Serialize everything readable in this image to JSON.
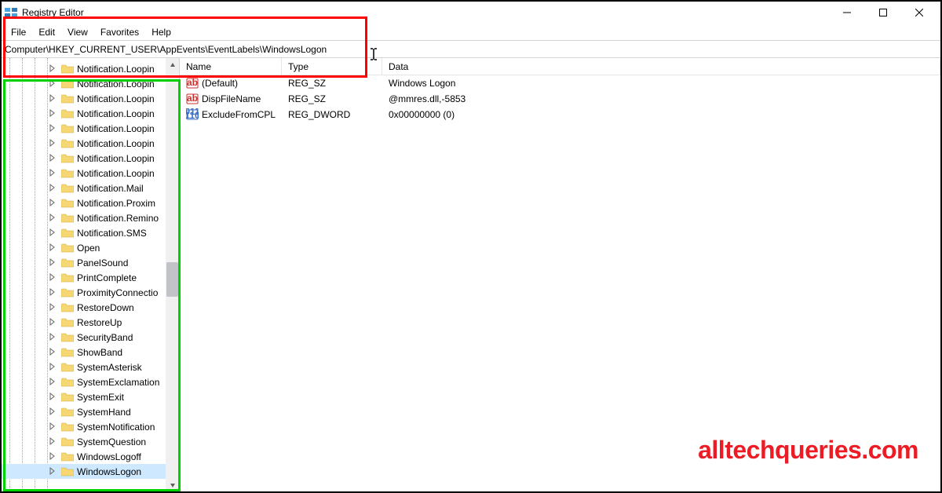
{
  "window": {
    "title": "Registry Editor"
  },
  "menu": {
    "file": "File",
    "edit": "Edit",
    "view": "View",
    "favorites": "Favorites",
    "help": "Help"
  },
  "address": {
    "path": "Computer\\HKEY_CURRENT_USER\\AppEvents\\EventLabels\\WindowsLogon"
  },
  "tree": {
    "items": [
      {
        "label": "Notification.Loopin",
        "selected": false
      },
      {
        "label": "Notification.Loopin",
        "selected": false
      },
      {
        "label": "Notification.Loopin",
        "selected": false
      },
      {
        "label": "Notification.Loopin",
        "selected": false
      },
      {
        "label": "Notification.Loopin",
        "selected": false
      },
      {
        "label": "Notification.Loopin",
        "selected": false
      },
      {
        "label": "Notification.Loopin",
        "selected": false
      },
      {
        "label": "Notification.Loopin",
        "selected": false
      },
      {
        "label": "Notification.Mail",
        "selected": false
      },
      {
        "label": "Notification.Proxim",
        "selected": false
      },
      {
        "label": "Notification.Remino",
        "selected": false
      },
      {
        "label": "Notification.SMS",
        "selected": false
      },
      {
        "label": "Open",
        "selected": false
      },
      {
        "label": "PanelSound",
        "selected": false
      },
      {
        "label": "PrintComplete",
        "selected": false
      },
      {
        "label": "ProximityConnectio",
        "selected": false
      },
      {
        "label": "RestoreDown",
        "selected": false
      },
      {
        "label": "RestoreUp",
        "selected": false
      },
      {
        "label": "SecurityBand",
        "selected": false
      },
      {
        "label": "ShowBand",
        "selected": false
      },
      {
        "label": "SystemAsterisk",
        "selected": false
      },
      {
        "label": "SystemExclamation",
        "selected": false
      },
      {
        "label": "SystemExit",
        "selected": false
      },
      {
        "label": "SystemHand",
        "selected": false
      },
      {
        "label": "SystemNotification",
        "selected": false
      },
      {
        "label": "SystemQuestion",
        "selected": false
      },
      {
        "label": "WindowsLogoff",
        "selected": false
      },
      {
        "label": "WindowsLogon",
        "selected": true
      }
    ]
  },
  "list": {
    "headers": {
      "name": "Name",
      "type": "Type",
      "data": "Data"
    },
    "rows": [
      {
        "name": "(Default)",
        "type": "REG_SZ",
        "data": "Windows Logon",
        "icon": "string"
      },
      {
        "name": "DispFileName",
        "type": "REG_SZ",
        "data": "@mmres.dll,-5853",
        "icon": "string"
      },
      {
        "name": "ExcludeFromCPL",
        "type": "REG_DWORD",
        "data": "0x00000000 (0)",
        "icon": "dword"
      }
    ]
  },
  "watermark": "alltechqueries.com"
}
